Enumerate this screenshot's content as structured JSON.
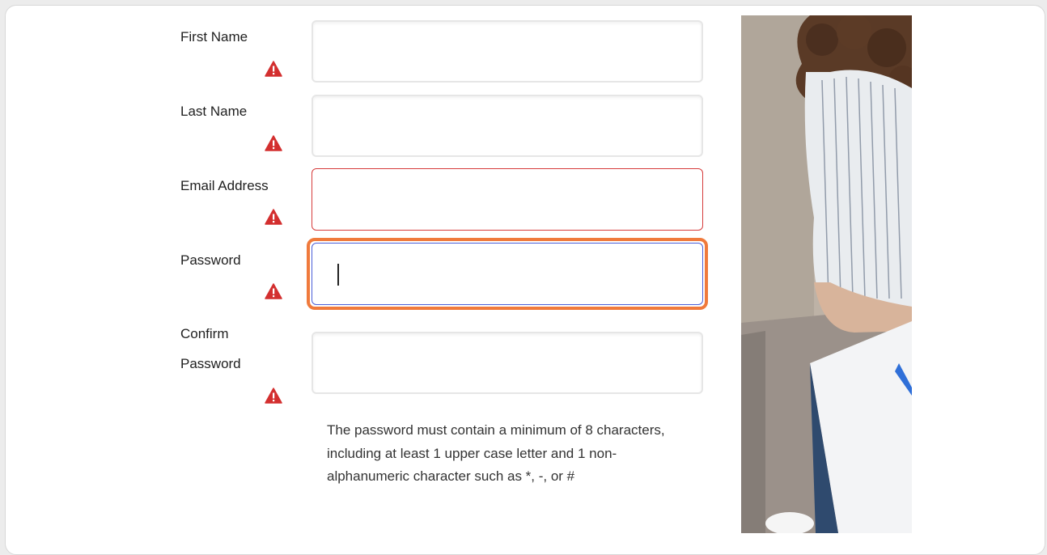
{
  "form": {
    "fields": [
      {
        "label": "First Name",
        "value": "",
        "state": "default"
      },
      {
        "label": "Last Name",
        "value": "",
        "state": "default"
      },
      {
        "label": "Email Address",
        "value": "",
        "state": "error"
      },
      {
        "label": "Password",
        "value": "",
        "state": "focused"
      },
      {
        "label_line1": "Confirm",
        "label_line2": "Password",
        "value": "",
        "state": "default"
      }
    ],
    "password_hint": "The password must contain a minimum of 8 characters, including at least 1 upper case letter and 1 non-alphanumeric character such as *, -, or #"
  },
  "colors": {
    "warning_icon": "#d32f2f",
    "error_border": "#d63b3b",
    "focus_ring": "#f07a3c",
    "focus_border": "#4a5fd8"
  }
}
